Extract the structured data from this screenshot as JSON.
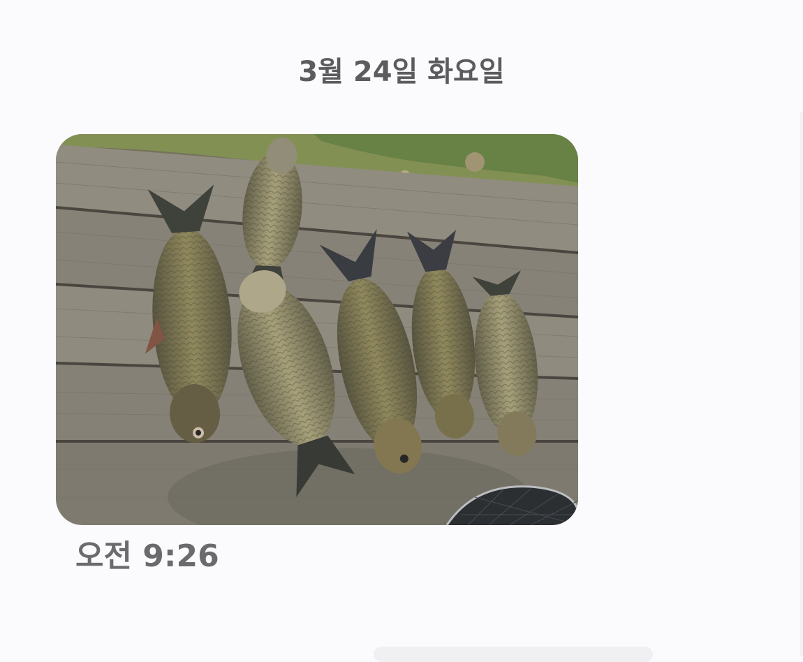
{
  "conversation": {
    "date_header": "3월 24일 화요일",
    "message": {
      "type": "image",
      "image_subject": "photo-fish-catch",
      "timestamp": "오전 9:26"
    }
  },
  "colors": {
    "background": "#fbfbfd",
    "date_text": "#5c5c5e",
    "timestamp_text": "#6b6b6d"
  }
}
